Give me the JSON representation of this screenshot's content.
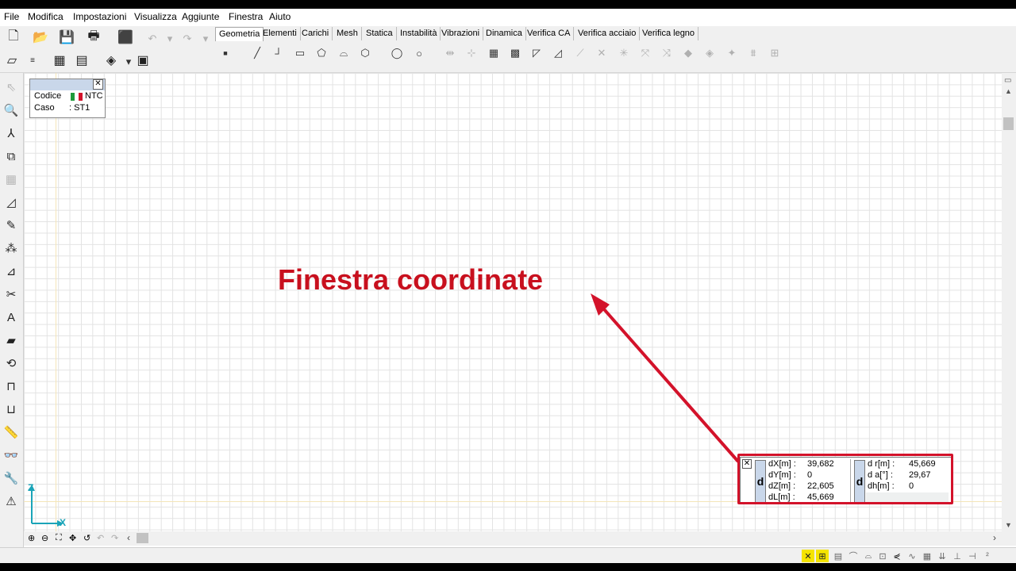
{
  "menu": {
    "items": [
      "File",
      "Modifica",
      "Impostazioni",
      "Visualizza",
      "Aggiunte",
      "Finestra",
      "Aiuto"
    ]
  },
  "tabs": {
    "items": [
      "Geometria",
      "Elementi",
      "Carichi",
      "Mesh",
      "Statica",
      "Instabilità",
      "Vibrazioni",
      "Dinamica",
      "Verifica CA",
      "Verifica acciaio",
      "Verifica legno"
    ],
    "active": "Geometria"
  },
  "info": {
    "codice_label": "Codice",
    "codice_value": "NTC",
    "caso_label": "Caso",
    "caso_value": ": ST1",
    "close": "✕"
  },
  "axes": {
    "z": "Z",
    "x": "X"
  },
  "annotation": {
    "text": "Finestra coordinate",
    "color": "#c8101e"
  },
  "coord": {
    "close": "✕",
    "left_tag": "d",
    "right_tag": "d",
    "left_rows": [
      {
        "label": "dX[m] :",
        "value": "39,682"
      },
      {
        "label": "dY[m] :",
        "value": "0"
      },
      {
        "label": "dZ[m] :",
        "value": "22,605"
      },
      {
        "label": "dL[m] :",
        "value": "45,669"
      }
    ],
    "right_rows": [
      {
        "label": "d r[m] :",
        "value": "45,669"
      },
      {
        "label": "d  a[°] :",
        "value": "29,67"
      },
      {
        "label": "dh[m] :",
        "value": "0"
      }
    ]
  },
  "colors": {
    "highlight": "#d3122a",
    "accent_panel": "#c9d7ea"
  }
}
